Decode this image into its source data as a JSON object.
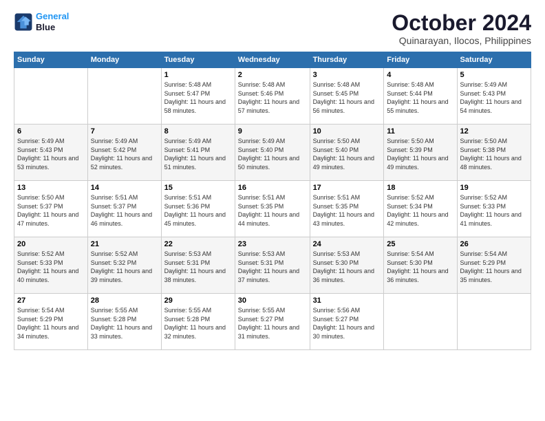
{
  "logo": {
    "line1": "General",
    "line2": "Blue"
  },
  "title": "October 2024",
  "location": "Quinarayan, Ilocos, Philippines",
  "header_days": [
    "Sunday",
    "Monday",
    "Tuesday",
    "Wednesday",
    "Thursday",
    "Friday",
    "Saturday"
  ],
  "weeks": [
    [
      {
        "day": "",
        "sunrise": "",
        "sunset": "",
        "daylight": ""
      },
      {
        "day": "",
        "sunrise": "",
        "sunset": "",
        "daylight": ""
      },
      {
        "day": "1",
        "sunrise": "Sunrise: 5:48 AM",
        "sunset": "Sunset: 5:47 PM",
        "daylight": "Daylight: 11 hours and 58 minutes."
      },
      {
        "day": "2",
        "sunrise": "Sunrise: 5:48 AM",
        "sunset": "Sunset: 5:46 PM",
        "daylight": "Daylight: 11 hours and 57 minutes."
      },
      {
        "day": "3",
        "sunrise": "Sunrise: 5:48 AM",
        "sunset": "Sunset: 5:45 PM",
        "daylight": "Daylight: 11 hours and 56 minutes."
      },
      {
        "day": "4",
        "sunrise": "Sunrise: 5:48 AM",
        "sunset": "Sunset: 5:44 PM",
        "daylight": "Daylight: 11 hours and 55 minutes."
      },
      {
        "day": "5",
        "sunrise": "Sunrise: 5:49 AM",
        "sunset": "Sunset: 5:43 PM",
        "daylight": "Daylight: 11 hours and 54 minutes."
      }
    ],
    [
      {
        "day": "6",
        "sunrise": "Sunrise: 5:49 AM",
        "sunset": "Sunset: 5:43 PM",
        "daylight": "Daylight: 11 hours and 53 minutes."
      },
      {
        "day": "7",
        "sunrise": "Sunrise: 5:49 AM",
        "sunset": "Sunset: 5:42 PM",
        "daylight": "Daylight: 11 hours and 52 minutes."
      },
      {
        "day": "8",
        "sunrise": "Sunrise: 5:49 AM",
        "sunset": "Sunset: 5:41 PM",
        "daylight": "Daylight: 11 hours and 51 minutes."
      },
      {
        "day": "9",
        "sunrise": "Sunrise: 5:49 AM",
        "sunset": "Sunset: 5:40 PM",
        "daylight": "Daylight: 11 hours and 50 minutes."
      },
      {
        "day": "10",
        "sunrise": "Sunrise: 5:50 AM",
        "sunset": "Sunset: 5:40 PM",
        "daylight": "Daylight: 11 hours and 49 minutes."
      },
      {
        "day": "11",
        "sunrise": "Sunrise: 5:50 AM",
        "sunset": "Sunset: 5:39 PM",
        "daylight": "Daylight: 11 hours and 49 minutes."
      },
      {
        "day": "12",
        "sunrise": "Sunrise: 5:50 AM",
        "sunset": "Sunset: 5:38 PM",
        "daylight": "Daylight: 11 hours and 48 minutes."
      }
    ],
    [
      {
        "day": "13",
        "sunrise": "Sunrise: 5:50 AM",
        "sunset": "Sunset: 5:37 PM",
        "daylight": "Daylight: 11 hours and 47 minutes."
      },
      {
        "day": "14",
        "sunrise": "Sunrise: 5:51 AM",
        "sunset": "Sunset: 5:37 PM",
        "daylight": "Daylight: 11 hours and 46 minutes."
      },
      {
        "day": "15",
        "sunrise": "Sunrise: 5:51 AM",
        "sunset": "Sunset: 5:36 PM",
        "daylight": "Daylight: 11 hours and 45 minutes."
      },
      {
        "day": "16",
        "sunrise": "Sunrise: 5:51 AM",
        "sunset": "Sunset: 5:35 PM",
        "daylight": "Daylight: 11 hours and 44 minutes."
      },
      {
        "day": "17",
        "sunrise": "Sunrise: 5:51 AM",
        "sunset": "Sunset: 5:35 PM",
        "daylight": "Daylight: 11 hours and 43 minutes."
      },
      {
        "day": "18",
        "sunrise": "Sunrise: 5:52 AM",
        "sunset": "Sunset: 5:34 PM",
        "daylight": "Daylight: 11 hours and 42 minutes."
      },
      {
        "day": "19",
        "sunrise": "Sunrise: 5:52 AM",
        "sunset": "Sunset: 5:33 PM",
        "daylight": "Daylight: 11 hours and 41 minutes."
      }
    ],
    [
      {
        "day": "20",
        "sunrise": "Sunrise: 5:52 AM",
        "sunset": "Sunset: 5:33 PM",
        "daylight": "Daylight: 11 hours and 40 minutes."
      },
      {
        "day": "21",
        "sunrise": "Sunrise: 5:52 AM",
        "sunset": "Sunset: 5:32 PM",
        "daylight": "Daylight: 11 hours and 39 minutes."
      },
      {
        "day": "22",
        "sunrise": "Sunrise: 5:53 AM",
        "sunset": "Sunset: 5:31 PM",
        "daylight": "Daylight: 11 hours and 38 minutes."
      },
      {
        "day": "23",
        "sunrise": "Sunrise: 5:53 AM",
        "sunset": "Sunset: 5:31 PM",
        "daylight": "Daylight: 11 hours and 37 minutes."
      },
      {
        "day": "24",
        "sunrise": "Sunrise: 5:53 AM",
        "sunset": "Sunset: 5:30 PM",
        "daylight": "Daylight: 11 hours and 36 minutes."
      },
      {
        "day": "25",
        "sunrise": "Sunrise: 5:54 AM",
        "sunset": "Sunset: 5:30 PM",
        "daylight": "Daylight: 11 hours and 36 minutes."
      },
      {
        "day": "26",
        "sunrise": "Sunrise: 5:54 AM",
        "sunset": "Sunset: 5:29 PM",
        "daylight": "Daylight: 11 hours and 35 minutes."
      }
    ],
    [
      {
        "day": "27",
        "sunrise": "Sunrise: 5:54 AM",
        "sunset": "Sunset: 5:29 PM",
        "daylight": "Daylight: 11 hours and 34 minutes."
      },
      {
        "day": "28",
        "sunrise": "Sunrise: 5:55 AM",
        "sunset": "Sunset: 5:28 PM",
        "daylight": "Daylight: 11 hours and 33 minutes."
      },
      {
        "day": "29",
        "sunrise": "Sunrise: 5:55 AM",
        "sunset": "Sunset: 5:28 PM",
        "daylight": "Daylight: 11 hours and 32 minutes."
      },
      {
        "day": "30",
        "sunrise": "Sunrise: 5:55 AM",
        "sunset": "Sunset: 5:27 PM",
        "daylight": "Daylight: 11 hours and 31 minutes."
      },
      {
        "day": "31",
        "sunrise": "Sunrise: 5:56 AM",
        "sunset": "Sunset: 5:27 PM",
        "daylight": "Daylight: 11 hours and 30 minutes."
      },
      {
        "day": "",
        "sunrise": "",
        "sunset": "",
        "daylight": ""
      },
      {
        "day": "",
        "sunrise": "",
        "sunset": "",
        "daylight": ""
      }
    ]
  ]
}
